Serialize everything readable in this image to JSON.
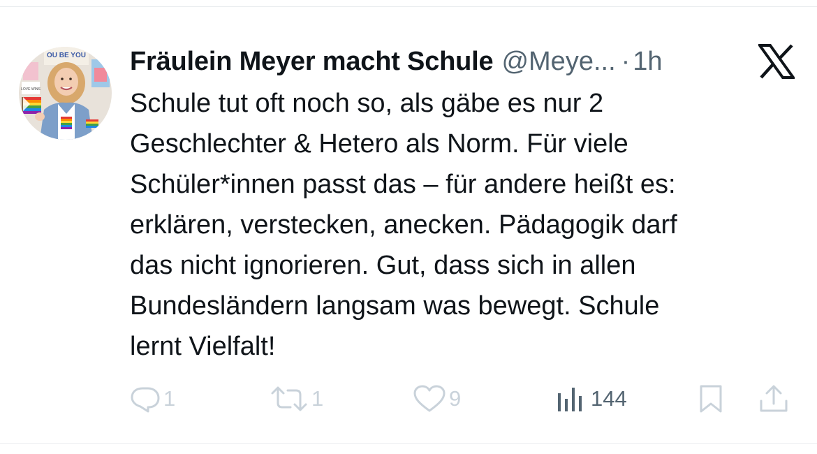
{
  "author": {
    "display_name": "Fräulein Meyer macht Schule",
    "handle": "@Meye...",
    "separator": "·",
    "time": "1h",
    "avatar_poster_text": "OU BE YOU",
    "avatar_sign_text": "LOVE WINS"
  },
  "tweet": {
    "lines": [
      "Schule tut oft noch so, als gäbe es nur 2",
      "Geschlechter & Hetero als Norm. Für viele",
      "Schüler*innen passt das – für andere heißt es:",
      "erklären, verstecken, anecken. Pädagogik darf",
      "das nicht ignorieren. Gut, dass sich in allen",
      "Bundesländern langsam was bewegt. Schule",
      "lernt Vielfalt!"
    ]
  },
  "actions": {
    "replies": "1",
    "reposts": "1",
    "likes": "9",
    "views": "144"
  },
  "icons": {
    "logo": "x-logo-icon",
    "reply": "reply-icon",
    "repost": "repost-icon",
    "like": "heart-icon",
    "views": "views-chart-icon",
    "bookmark": "bookmark-icon",
    "share": "share-icon"
  },
  "colors": {
    "text": "#0f1419",
    "secondary": "#536471",
    "muted_action": "#c9d2da",
    "divider": "#e9ecef"
  }
}
